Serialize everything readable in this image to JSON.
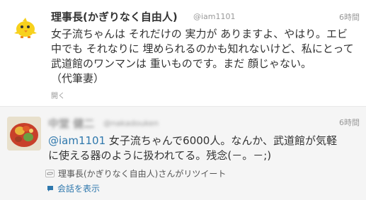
{
  "tweets": [
    {
      "name": "理事長(かぎりなく自由人)",
      "screen_name": "@iam1101",
      "time": "6時間",
      "text_lines": [
        "女子流ちゃんは それだけの 実力が ありますよ、やはり。エビ",
        "中でも それなりに 埋められるのかも知れないけど、私にとって",
        " 武道館のワンマンは 重いものです。まだ 顔じゃない。",
        "（代筆妻）"
      ],
      "expand_label": "開く",
      "avatar_icon": "chick-icon"
    },
    {
      "name": "中堂 健二",
      "screen_name": "@nakadouken",
      "time": "6時間",
      "mention": "@iam1101",
      "text_first_rest": " 女子流ちゃんで6000人。なんか、武道館が気軽",
      "text_second": "に使える器のように扱われてる。残念(－。－;)",
      "retweet_label": "理事長(かぎりなく自由人)さんがリツイート",
      "conversation_label": "会話を表示",
      "avatar_icon": "food-photo-icon"
    }
  ],
  "colors": {
    "link": "#2f78ad",
    "text": "#333333",
    "muted": "#999999",
    "tweet2_bg": "#f5f5f5"
  }
}
